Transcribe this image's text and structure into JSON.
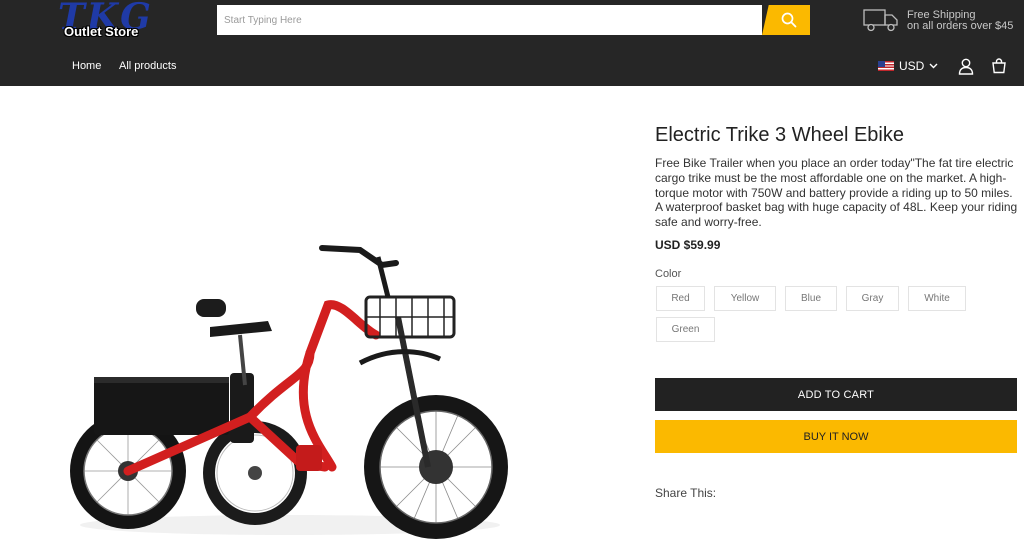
{
  "header": {
    "logo": {
      "big": "TKG",
      "small": "Outlet Store"
    },
    "search": {
      "placeholder": "Start Typing Here",
      "value": ""
    },
    "shipping": {
      "line1": "Free Shipping",
      "line2": "on all orders over $45"
    },
    "nav": [
      {
        "label": "Home"
      },
      {
        "label": "All products"
      }
    ],
    "currency": "USD",
    "icons": {
      "search": "search-icon",
      "truck": "truck-icon",
      "user": "user-icon",
      "cart": "cart-icon",
      "chevron": "chevron-down-icon",
      "flag": "us-flag-icon"
    }
  },
  "product": {
    "title": "Electric Trike 3 Wheel Ebike",
    "description": "Free Bike Trailer when you place an order today\"The fat tire electric cargo trike must be the most affordable one on the market. A high-torque motor with 750W and battery provide a riding up to 50 miles. A waterproof basket bag with huge capacity of 48L. Keep your riding safe and worry-free.",
    "price": "USD $59.99",
    "color_label": "Color",
    "colors": [
      "Red",
      "Yellow",
      "Blue",
      "Gray",
      "White",
      "Green"
    ],
    "add_to_cart": "ADD TO CART",
    "buy_now": "BUY IT NOW",
    "share": "Share This:"
  },
  "colors": {
    "header_bg": "#262626",
    "accent": "#fbb900",
    "button_dark": "#222222",
    "trike_frame": "#d21f1f"
  }
}
